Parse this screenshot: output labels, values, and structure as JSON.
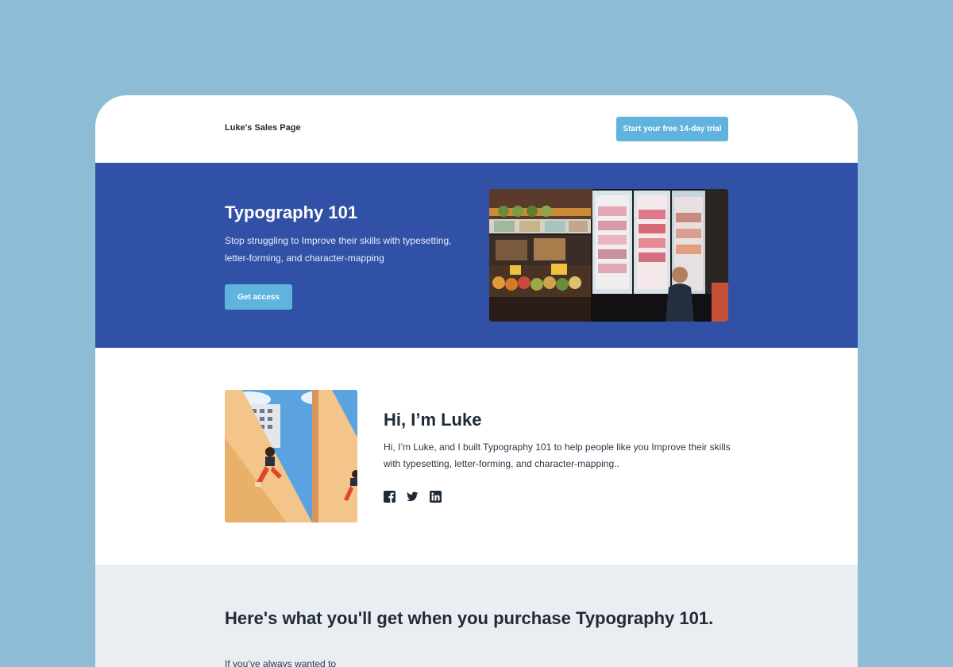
{
  "header": {
    "brand": "Luke's Sales Page",
    "cta": "Start your free 14-day trial"
  },
  "hero": {
    "title": "Typography 101",
    "subtitle": "Stop struggling to Improve their skills with typesetting, letter-forming, and character-mapping",
    "button": "Get access",
    "image_icon": "market-shop-photo"
  },
  "about": {
    "title": "Hi, I’m Luke",
    "text": "Hi, I’m Luke, and I built Typography 101 to help people like you Improve their skills with typesetting, letter-forming, and character-mapping..",
    "image_icon": "person-sitting-photo",
    "socials": [
      "facebook-icon",
      "twitter-icon",
      "linkedin-icon"
    ]
  },
  "features": {
    "title": "Here's what you'll get when you purchase Typography 101.",
    "text": "If you’ve always wanted to"
  },
  "colors": {
    "background": "#8dbdd6",
    "hero": "#3151a6",
    "accent": "#5fb3dd",
    "features_bg": "#eaedf1"
  }
}
